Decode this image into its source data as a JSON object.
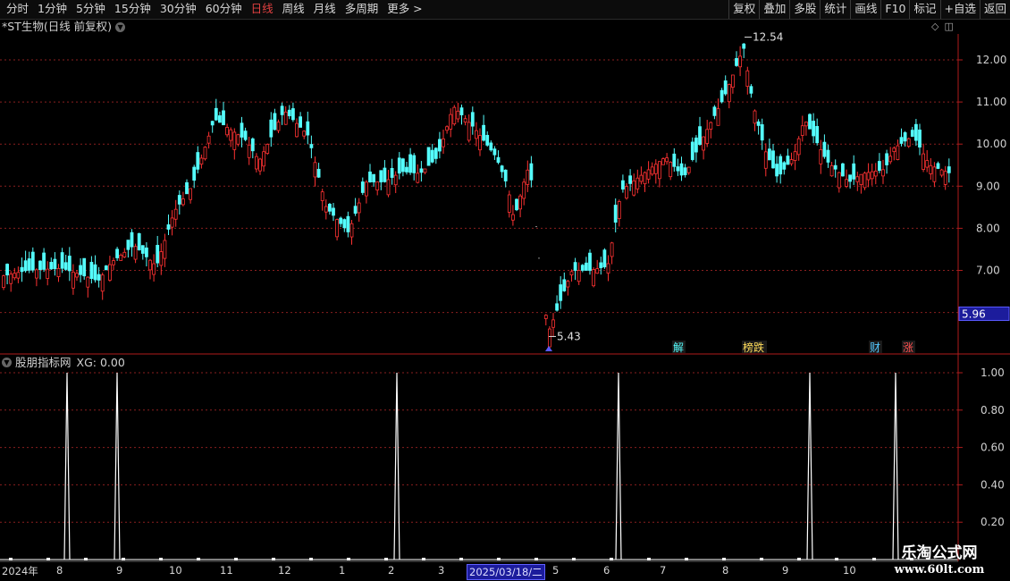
{
  "toolbar": {
    "periods": [
      "分时",
      "1分钟",
      "5分钟",
      "15分钟",
      "30分钟",
      "60分钟",
      "日线",
      "周线",
      "月线",
      "多周期",
      "更多 >"
    ],
    "active_period": "日线",
    "actions": [
      "复权",
      "叠加",
      "多股",
      "统计",
      "画线",
      "F10",
      "标记",
      "+自选",
      "返回"
    ]
  },
  "main_chart": {
    "title": "*ST生物(日线 前复权)",
    "high_label": "12.54",
    "low_label": "5.43",
    "current_price": "5.96",
    "price_axis": [
      "12.00",
      "11.00",
      "10.00",
      "9.00",
      "8.00",
      "7.00",
      "6.00"
    ],
    "event_markers": [
      "解",
      "榜跌",
      "财",
      "涨"
    ],
    "colors": {
      "up": "#ff3232",
      "down": "#54fcfc",
      "grid": "#8a1f1f",
      "axis": "#b01c1c",
      "price_tag": "#1c1c9c"
    }
  },
  "indicator": {
    "title": "股朋指标网",
    "series_label": "XG: 0.00",
    "axis": [
      "1.00",
      "0.80",
      "0.60",
      "0.40",
      "0.20"
    ],
    "signal_dates_labels_x": [
      "8",
      "9",
      "2",
      "6",
      "9",
      "10"
    ]
  },
  "date_axis": {
    "labels": [
      "2024年",
      "8",
      "9",
      "10",
      "11",
      "12",
      "1",
      "2",
      "3",
      "5",
      "6",
      "7",
      "8",
      "9",
      "10"
    ],
    "selected": "2025/03/18/二"
  },
  "watermark": {
    "line1": "乐淘公式网",
    "line2": "www.60lt.com"
  },
  "chart_data": {
    "type": "candlestick",
    "title": "*ST生物(日线 前复权)",
    "ylim": [
      5.2,
      12.8
    ],
    "y_ticks": [
      6,
      7,
      8,
      9,
      10,
      11,
      12
    ],
    "annotated_high": 12.54,
    "annotated_low": 5.43,
    "last_price": 5.96,
    "x_labels": [
      "2024年",
      "8",
      "9",
      "10",
      "11",
      "12",
      "1",
      "2",
      "3",
      "2025/03/18/二",
      "5",
      "6",
      "7",
      "8",
      "9",
      "10"
    ],
    "indicator": {
      "name": "XG",
      "value": 0.0,
      "ylim": [
        0,
        1
      ],
      "signal_values": [
        1,
        1,
        1,
        1,
        1,
        1
      ]
    }
  }
}
